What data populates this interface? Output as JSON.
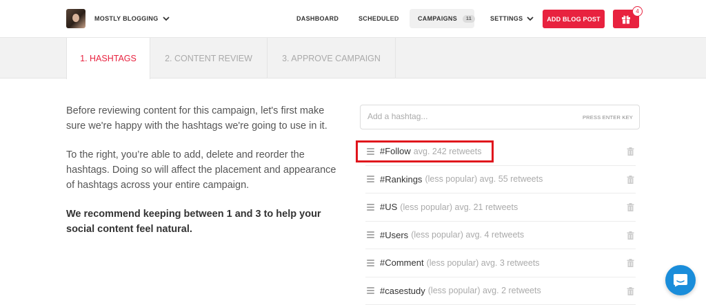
{
  "header": {
    "brand_name": "MOSTLY BLOGGING",
    "nav": {
      "dashboard": "DASHBOARD",
      "scheduled": "SCHEDULED",
      "campaigns": "CAMPAIGNS",
      "campaigns_count": "11",
      "settings": "SETTINGS"
    },
    "add_blog_post": "ADD BLOG POST",
    "gift_badge": "4",
    "accent_color": "#e8223f"
  },
  "steps": [
    {
      "label": "1. HASHTAGS",
      "active": true
    },
    {
      "label": "2. CONTENT REVIEW",
      "active": false
    },
    {
      "label": "3. APPROVE CAMPAIGN",
      "active": false
    }
  ],
  "intro": {
    "p1": "Before reviewing content for this campaign, let's first make sure we're happy with the hashtags we're going to use in it.",
    "p2": "To the right, you’re able to add, delete and reorder the hashtags. Doing so will affect the placement and appearance of hashtags across your entire campaign.",
    "p3": "We recommend keeping between 1 and 3 to help your social content feel natural."
  },
  "hashtag_input": {
    "placeholder": "Add a hashtag...",
    "value": "",
    "hint": "PRESS ENTER KEY"
  },
  "hashtags": [
    {
      "tag": "#Follow",
      "meta": "avg. 242 retweets"
    },
    {
      "tag": "#Rankings",
      "meta": "(less popular) avg. 55 retweets"
    },
    {
      "tag": "#US",
      "meta": "(less popular) avg. 21 retweets"
    },
    {
      "tag": "#Users",
      "meta": "(less popular) avg. 4 retweets"
    },
    {
      "tag": "#Comment",
      "meta": "(less popular) avg. 3 retweets"
    },
    {
      "tag": "#casestudy",
      "meta": "(less popular) avg. 2 retweets"
    }
  ],
  "icons": {
    "brand_chevron": "chevron-down-icon",
    "settings_chevron": "chevron-down-icon",
    "gift": "gift-icon",
    "drag": "drag-handle-icon",
    "trash": "trash-icon",
    "chat": "chat-icon"
  }
}
